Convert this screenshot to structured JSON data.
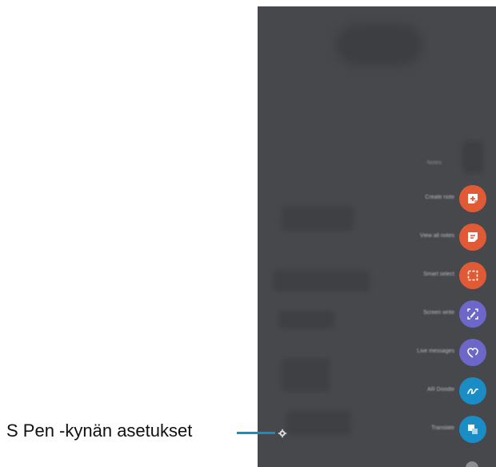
{
  "menu": {
    "title": "Notes",
    "items": [
      {
        "label": "Create note",
        "icon": "create-note-icon",
        "color": "#e05a36"
      },
      {
        "label": "View all notes",
        "icon": "view-notes-icon",
        "color": "#e05a36"
      },
      {
        "label": "Smart select",
        "icon": "smart-select-icon",
        "color": "#e05a36"
      },
      {
        "label": "Screen write",
        "icon": "screen-write-icon",
        "color": "#6c67c9"
      },
      {
        "label": "Live messages",
        "icon": "live-messages-icon",
        "color": "#6c67c9"
      },
      {
        "label": "AR Doodle",
        "icon": "ar-doodle-icon",
        "color": "#1a8dc6"
      },
      {
        "label": "Translate",
        "icon": "translate-icon",
        "color": "#1a8dc6"
      }
    ]
  },
  "callout": {
    "text": "S Pen -kynän asetukset",
    "line_color": "#1a8dc6"
  },
  "colors": {
    "panel_bg": "#47484c",
    "accent_orange": "#e05a36",
    "accent_purple": "#6c67c9",
    "accent_blue": "#1a8dc6"
  }
}
